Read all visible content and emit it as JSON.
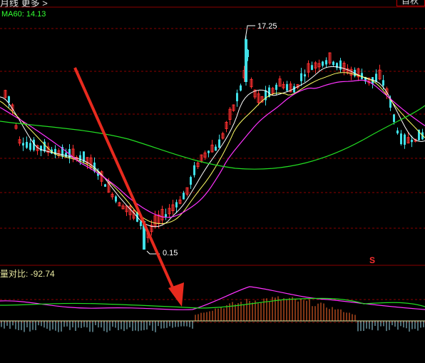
{
  "header": {
    "title": "月线 更多 >",
    "button_label": "自秋"
  },
  "main_chart": {
    "ma_label": "MA60: 14.13",
    "high_annotation": "17.25",
    "low_annotation": "0.15",
    "signal_glyph": "S"
  },
  "indicator": {
    "label": "量对比: -92.74"
  },
  "colors": {
    "background": "#000000",
    "up": "#ff3030",
    "down": "#40e0e8",
    "ma_fast": "#ffffff",
    "ma_mid": "#ffff66",
    "ma_slow": "#ff33ff",
    "ma60": "#22dd22",
    "grid": "#8b0000",
    "arrow": "#e82a1e"
  }
}
